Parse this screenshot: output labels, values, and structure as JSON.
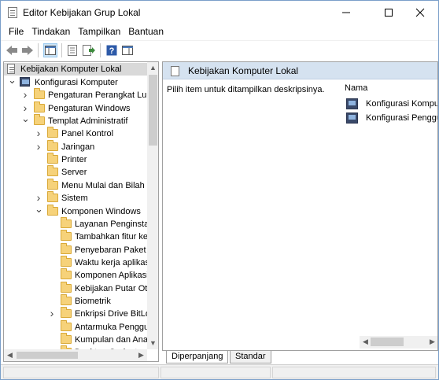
{
  "window": {
    "title": "Editor Kebijakan Grup Lokal"
  },
  "menu": [
    "File",
    "Tindakan",
    "Tampilkan",
    "Bantuan"
  ],
  "toolbar": {
    "icons": [
      "back-icon",
      "forward-icon",
      "show-hide-console-tree-icon",
      "properties-icon",
      "export-list-icon",
      "help-icon",
      "show-action-pane-icon"
    ]
  },
  "tree": {
    "root": "Kebijakan Komputer Lokal",
    "items": [
      {
        "label": "Konfigurasi Komputer",
        "icon": "computer-icon",
        "expander": "expanded"
      },
      {
        "label": "Pengaturan Perangkat Lunak",
        "icon": "folder-icon",
        "expander": "collapsed"
      },
      {
        "label": "Pengaturan Windows",
        "icon": "folder-icon",
        "expander": "collapsed"
      },
      {
        "label": "Templat Administratif",
        "icon": "folder-icon",
        "expander": "expanded"
      },
      {
        "label": "Panel Kontrol",
        "icon": "folder-icon",
        "expander": "collapsed"
      },
      {
        "label": "Jaringan",
        "icon": "folder-icon",
        "expander": "collapsed"
      },
      {
        "label": "Printer",
        "icon": "folder-icon",
        "expander": ""
      },
      {
        "label": "Server",
        "icon": "folder-icon",
        "expander": ""
      },
      {
        "label": "Menu Mulai dan Bilah",
        "icon": "folder-icon",
        "expander": ""
      },
      {
        "label": "Sistem",
        "icon": "folder-icon",
        "expander": "collapsed"
      },
      {
        "label": "Komponen Windows",
        "icon": "folder-icon",
        "expander": "expanded"
      },
      {
        "label": "Layanan Penginstal",
        "icon": "folder-icon",
        "expander": ""
      },
      {
        "label": "Tambahkan fitur ke",
        "icon": "folder-icon",
        "expander": ""
      },
      {
        "label": "Penyebaran Paket A",
        "icon": "folder-icon",
        "expander": ""
      },
      {
        "label": "Waktu kerja aplikasi",
        "icon": "folder-icon",
        "expander": ""
      },
      {
        "label": "Komponen Aplikasi",
        "icon": "folder-icon",
        "expander": ""
      },
      {
        "label": "Kebijakan Putar Ot",
        "icon": "folder-icon",
        "expander": ""
      },
      {
        "label": "Biometrik",
        "icon": "folder-icon",
        "expander": ""
      },
      {
        "label": "Enkripsi Drive BitLo",
        "icon": "folder-icon",
        "expander": "collapsed"
      },
      {
        "label": "Antarmuka Penggu",
        "icon": "folder-icon",
        "expander": ""
      },
      {
        "label": "Kumpulan dan Ana",
        "icon": "folder-icon",
        "expander": ""
      },
      {
        "label": "Desktop Gadget",
        "icon": "folder-icon",
        "expander": ""
      }
    ]
  },
  "details": {
    "header": "Kebijakan Komputer Lokal",
    "description": "Pilih item untuk ditampilkan deskripsinya.",
    "column_name": "Nama",
    "items": [
      {
        "label": "Konfigurasi Komputer",
        "icon": "computer-config-icon"
      },
      {
        "label": "Konfigurasi Pengguna",
        "icon": "user-config-icon"
      }
    ]
  },
  "tabs": [
    "Diperpanjang",
    "Standar"
  ]
}
